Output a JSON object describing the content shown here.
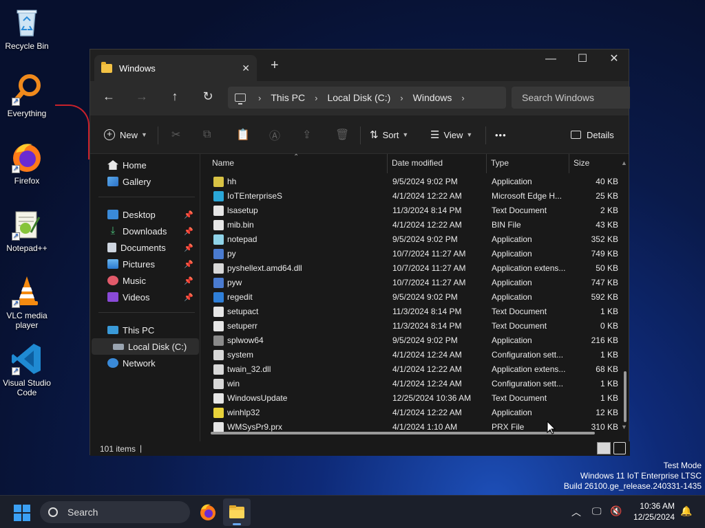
{
  "desktop": {
    "icons": [
      {
        "label": "Recycle Bin"
      },
      {
        "label": "Everything"
      },
      {
        "label": "Firefox"
      },
      {
        "label": "Notepad++"
      },
      {
        "label": "VLC media player"
      },
      {
        "label": "Visual Studio Code"
      }
    ]
  },
  "window": {
    "tab_title": "Windows",
    "new_tab": "+",
    "controls": {
      "minimize": "—",
      "maximize": "☐",
      "close": "✕"
    },
    "breadcrumb": [
      "This PC",
      "Local Disk (C:)",
      "Windows"
    ],
    "search_placeholder": "Search Windows",
    "toolbar": {
      "new_label": "New",
      "sort_label": "Sort",
      "view_label": "View",
      "more_label": "•••",
      "details_label": "Details"
    },
    "columns": {
      "name": "Name",
      "date": "Date modified",
      "type": "Type",
      "size": "Size"
    },
    "sidebar": {
      "home": "Home",
      "gallery": "Gallery",
      "quick": [
        "Desktop",
        "Downloads",
        "Documents",
        "Pictures",
        "Music",
        "Videos"
      ],
      "this_pc": "This PC",
      "local_disk": "Local Disk (C:)",
      "network": "Network"
    },
    "files": [
      {
        "name": "hh",
        "date": "9/5/2024 9:02 PM",
        "type": "Application",
        "size": "40 KB",
        "icon": "hh-icon",
        "color": "#d8c244"
      },
      {
        "name": "IoTEnterpriseS",
        "date": "4/1/2024 12:22 AM",
        "type": "Microsoft Edge H...",
        "size": "25 KB",
        "icon": "edge-icon",
        "color": "#2aa7d8"
      },
      {
        "name": "lsasetup",
        "date": "11/3/2024 8:14 PM",
        "type": "Text Document",
        "size": "2 KB",
        "icon": "text-file-icon",
        "color": "#e6e6e6"
      },
      {
        "name": "mib.bin",
        "date": "4/1/2024 12:22 AM",
        "type": "BIN File",
        "size": "43 KB",
        "icon": "bin-file-icon",
        "color": "#e6e6e6"
      },
      {
        "name": "notepad",
        "date": "9/5/2024 9:02 PM",
        "type": "Application",
        "size": "352 KB",
        "icon": "notepad-icon",
        "color": "#8fd3e8"
      },
      {
        "name": "py",
        "date": "10/7/2024 11:27 AM",
        "type": "Application",
        "size": "749 KB",
        "icon": "python-icon",
        "color": "#4a7bd0"
      },
      {
        "name": "pyshellext.amd64.dll",
        "date": "10/7/2024 11:27 AM",
        "type": "Application extens...",
        "size": "50 KB",
        "icon": "dll-file-icon",
        "color": "#d8d8d8"
      },
      {
        "name": "pyw",
        "date": "10/7/2024 11:27 AM",
        "type": "Application",
        "size": "747 KB",
        "icon": "python-icon",
        "color": "#4a7bd0"
      },
      {
        "name": "regedit",
        "date": "9/5/2024 9:02 PM",
        "type": "Application",
        "size": "592 KB",
        "icon": "regedit-icon",
        "color": "#2f7fd8"
      },
      {
        "name": "setupact",
        "date": "11/3/2024 8:14 PM",
        "type": "Text Document",
        "size": "1 KB",
        "icon": "text-file-icon",
        "color": "#e6e6e6"
      },
      {
        "name": "setuperr",
        "date": "11/3/2024 8:14 PM",
        "type": "Text Document",
        "size": "0 KB",
        "icon": "text-file-icon",
        "color": "#e6e6e6"
      },
      {
        "name": "splwow64",
        "date": "9/5/2024 9:02 PM",
        "type": "Application",
        "size": "216 KB",
        "icon": "printer-icon",
        "color": "#8a8a8a"
      },
      {
        "name": "system",
        "date": "4/1/2024 12:24 AM",
        "type": "Configuration sett...",
        "size": "1 KB",
        "icon": "config-file-icon",
        "color": "#d8d8d8"
      },
      {
        "name": "twain_32.dll",
        "date": "4/1/2024 12:22 AM",
        "type": "Application extens...",
        "size": "68 KB",
        "icon": "dll-file-icon",
        "color": "#d8d8d8"
      },
      {
        "name": "win",
        "date": "4/1/2024 12:24 AM",
        "type": "Configuration sett...",
        "size": "1 KB",
        "icon": "config-file-icon",
        "color": "#d8d8d8"
      },
      {
        "name": "WindowsUpdate",
        "date": "12/25/2024 10:36 AM",
        "type": "Text Document",
        "size": "1 KB",
        "icon": "text-file-icon",
        "color": "#e6e6e6"
      },
      {
        "name": "winhlp32",
        "date": "4/1/2024 12:22 AM",
        "type": "Application",
        "size": "12 KB",
        "icon": "help-icon",
        "color": "#e8d23a"
      },
      {
        "name": "WMSysPr9.prx",
        "date": "4/1/2024 1:10 AM",
        "type": "PRX File",
        "size": "310 KB",
        "icon": "prx-file-icon",
        "color": "#e6e6e6"
      }
    ],
    "status": "101 items"
  },
  "watermark": {
    "line1": "Test Mode",
    "line2": "Windows 11 IoT Enterprise LTSC",
    "line3": "Build 26100.ge_release.240331-1435"
  },
  "taskbar": {
    "search_placeholder": "Search",
    "time": "10:36 AM",
    "date": "12/25/2024"
  }
}
